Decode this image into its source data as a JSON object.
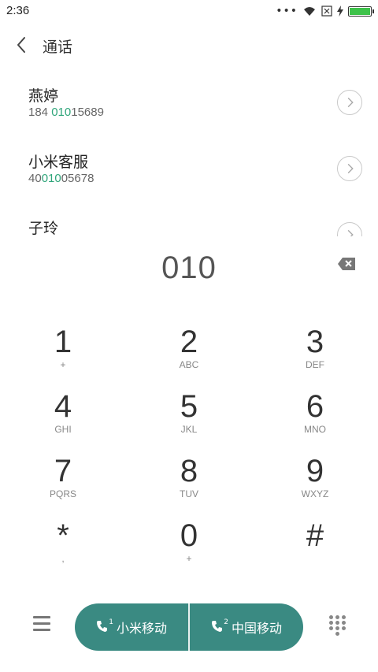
{
  "status_bar": {
    "time": "2:36",
    "more": "•••",
    "icons": [
      "wifi-icon",
      "sim-off-icon",
      "charging-icon",
      "battery-icon"
    ],
    "battery_color": "#3ec24a"
  },
  "header": {
    "title": "通话",
    "back_icon": "chevron-left-icon"
  },
  "contacts": [
    {
      "name": "燕婷",
      "number_parts": [
        "184 ",
        "010",
        "15689"
      ]
    },
    {
      "name": "小米客服",
      "number_parts": [
        "40",
        "010",
        "05678"
      ]
    },
    {
      "name": "子玲",
      "number_parts": [
        "",
        "",
        ""
      ]
    }
  ],
  "dial": {
    "entered": "010"
  },
  "keys": [
    {
      "digit": "1",
      "letters": "+"
    },
    {
      "digit": "2",
      "letters": "ABC"
    },
    {
      "digit": "3",
      "letters": "DEF"
    },
    {
      "digit": "4",
      "letters": "GHI"
    },
    {
      "digit": "5",
      "letters": "JKL"
    },
    {
      "digit": "6",
      "letters": "MNO"
    },
    {
      "digit": "7",
      "letters": "PQRS"
    },
    {
      "digit": "8",
      "letters": "TUV"
    },
    {
      "digit": "9",
      "letters": "WXYZ"
    },
    {
      "digit": "*",
      "letters": ","
    },
    {
      "digit": "0",
      "letters": "+"
    },
    {
      "digit": "#",
      "letters": ""
    }
  ],
  "call_buttons": [
    {
      "sim": "1",
      "label": "小米移动"
    },
    {
      "sim": "2",
      "label": "中国移动"
    }
  ],
  "colors": {
    "accent": "#3a8a82",
    "highlight": "#2fa57a"
  }
}
